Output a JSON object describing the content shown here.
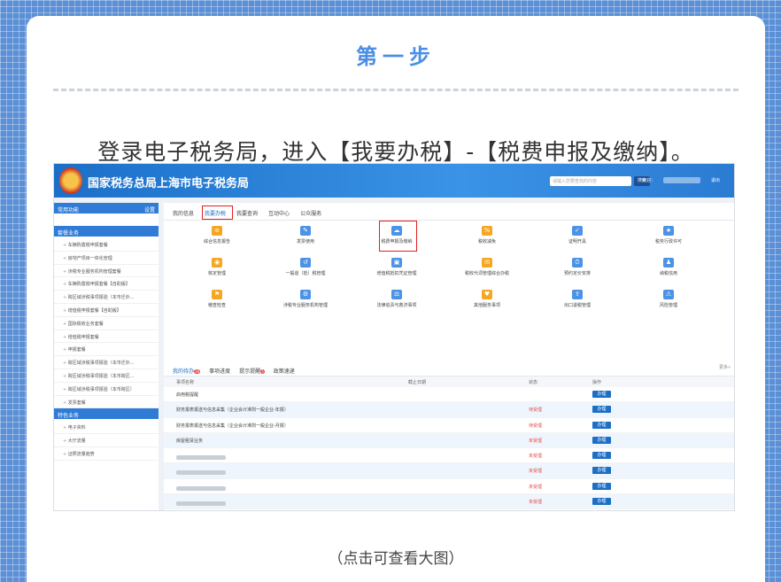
{
  "step_title": "第一步",
  "instruction": "登录电子税务局，进入【我要办税】-【税费申报及缴纳】。",
  "caption": "（点击可查看大图）",
  "screenshot": {
    "site_title": "国家税务总局上海市电子税务局",
    "search_placeholder": "请输入您要查找的内容",
    "search_button": "搜索",
    "welcome": "欢迎：",
    "exit": "退出",
    "sidebar": {
      "head1": {
        "label": "常用功能",
        "action": "设置"
      },
      "head2": {
        "label": "套餐业务"
      },
      "head3": {
        "label": "特色业务"
      },
      "items_a": [
        "车辆购置税申报套餐",
        "房地产项目一体化管理",
        "涉税专业服务机构管理套餐",
        "车辆购置税申报套餐【自助版】",
        "跨区域涉税事项报验（本市迁外...",
        "增值税申报套餐【自助版】",
        "国际税收业务套餐",
        "增值税申报套餐",
        "申报套餐",
        "跨区域涉税事项报验（本市迁外...",
        "跨区域涉税事项报验（本市跨区...",
        "跨区域涉税事项报验（本市跨区）",
        "发票套餐"
      ],
      "items_b": [
        "电子资料",
        "大厅流量",
        "证照流量趋势"
      ]
    },
    "tabs": [
      "我的信息",
      "我要办税",
      "我要查询",
      "互动中心",
      "公众服务"
    ],
    "active_tab": 1,
    "tiles": [
      "综合信息报告",
      "发票使用",
      "税费申报及缴纳",
      "税收减免",
      "证明开具",
      "税务行政许可",
      "核定管理",
      "一般退（抵）税管理",
      "增值税抵扣凭证管理",
      "税收代词管理综合办税",
      "预约定价安排",
      "纳税信用",
      "稽查检查",
      "涉税专业服务机构管理",
      "法律追责与救济事项",
      "其他服务事项",
      "出口退税管理",
      "风险管理"
    ],
    "list_tabs": [
      {
        "label": "我的待办",
        "badge": "28"
      },
      {
        "label": "事项进度",
        "badge": ""
      },
      {
        "label": "提示提醒",
        "badge": "3"
      },
      {
        "label": "政策速递",
        "badge": ""
      }
    ],
    "more": "更多»",
    "columns": [
      "事项名称",
      "截止日期",
      "状态",
      "操作"
    ],
    "rows": [
      {
        "name": "启用税提醒",
        "status": "",
        "op": "办理"
      },
      {
        "name": "财务报表报送与信息采集（企业会计准则一般企业-年报）",
        "status": "待受理",
        "op": "办理"
      },
      {
        "name": "财务报表报送与信息采集（企业会计准则一般企业-月报）",
        "status": "待受理",
        "op": "办理"
      },
      {
        "name": "房屋租赁业务",
        "status": "未受理",
        "op": "办理"
      },
      {
        "name": "",
        "status": "未受理",
        "op": "办理"
      },
      {
        "name": "",
        "status": "未受理",
        "op": "办理"
      },
      {
        "name": "",
        "status": "未受理",
        "op": "办理"
      },
      {
        "name": "",
        "status": "未受理",
        "op": "办理"
      },
      {
        "name": "",
        "status": "未受理",
        "op": "办理"
      },
      {
        "name": "",
        "status": "未受理",
        "op": "办理"
      }
    ]
  }
}
